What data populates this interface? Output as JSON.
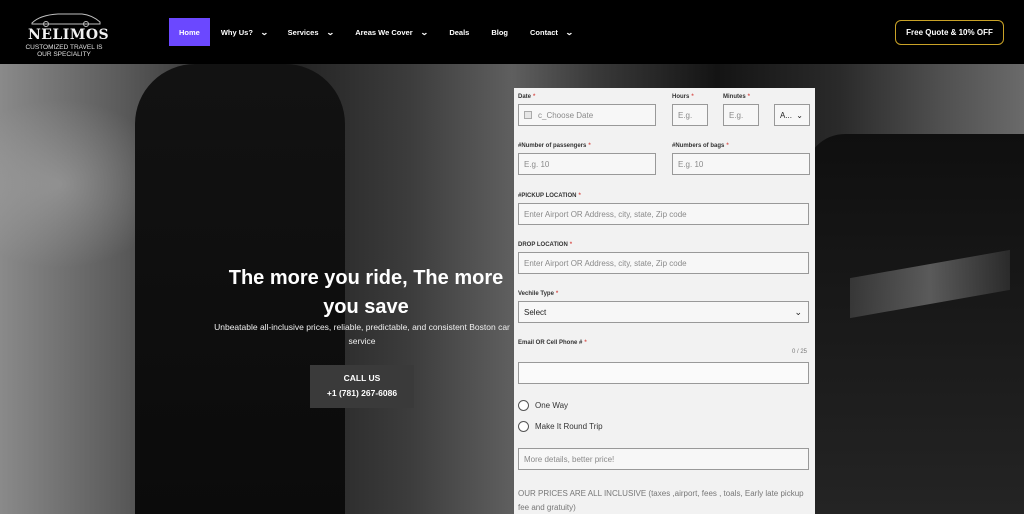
{
  "header": {
    "logo": {
      "name": "NELIMOS",
      "tagline_1": "CUSTOMIZED TRAVEL IS",
      "tagline_2": "OUR SPECIALITY"
    },
    "nav": [
      {
        "label": "Home",
        "active": true,
        "dropdown": false
      },
      {
        "label": "Why Us?",
        "active": false,
        "dropdown": true
      },
      {
        "label": "Services",
        "active": false,
        "dropdown": true
      },
      {
        "label": "Areas We Cover",
        "active": false,
        "dropdown": true
      },
      {
        "label": "Deals",
        "active": false,
        "dropdown": false
      },
      {
        "label": "Blog",
        "active": false,
        "dropdown": false
      },
      {
        "label": "Contact",
        "active": false,
        "dropdown": true
      }
    ],
    "quote_button": "Free Quote & 10% OFF",
    "colors": {
      "accent": "#6b48ff",
      "border_gold": "#c9a227"
    }
  },
  "hero": {
    "title": "The more you ride, The more you save",
    "subtitle": "Unbeatable all-inclusive prices, reliable, predictable, and consistent Boston car service",
    "call_button": {
      "label": "CALL US",
      "phone": "+1 (781) 267-6086"
    }
  },
  "form": {
    "date": {
      "label": "Date",
      "placeholder": "c_Choose Date"
    },
    "hours": {
      "label": "Hours",
      "placeholder": "E.g."
    },
    "minutes": {
      "label": "Minutes",
      "placeholder": "E.g."
    },
    "ampm": {
      "value": "A..."
    },
    "passengers": {
      "label": "#Number of passengers",
      "placeholder": "E.g. 10"
    },
    "bags": {
      "label": "#Numbers of bags",
      "placeholder": "E.g. 10"
    },
    "pickup": {
      "label": "#PICKUP LOCATION",
      "placeholder": "Enter Airport OR Address, city, state, Zip code"
    },
    "drop": {
      "label": "DROP LOCATION",
      "placeholder": "Enter Airport OR Address, city, state, Zip code"
    },
    "vehicle": {
      "label": "Vechile Type",
      "value": "Select"
    },
    "contact": {
      "label": "Email OR Cell Phone #",
      "counter": "0 / 25"
    },
    "trip_options": [
      "One Way",
      "Make It Round Trip"
    ],
    "details": {
      "placeholder": "More details, better price!"
    },
    "note": "OUR PRICES ARE ALL INCLUSIVE (taxes ,airport, fees , toals, Early late pickup fee and gratuity)",
    "required_mark": "*"
  }
}
